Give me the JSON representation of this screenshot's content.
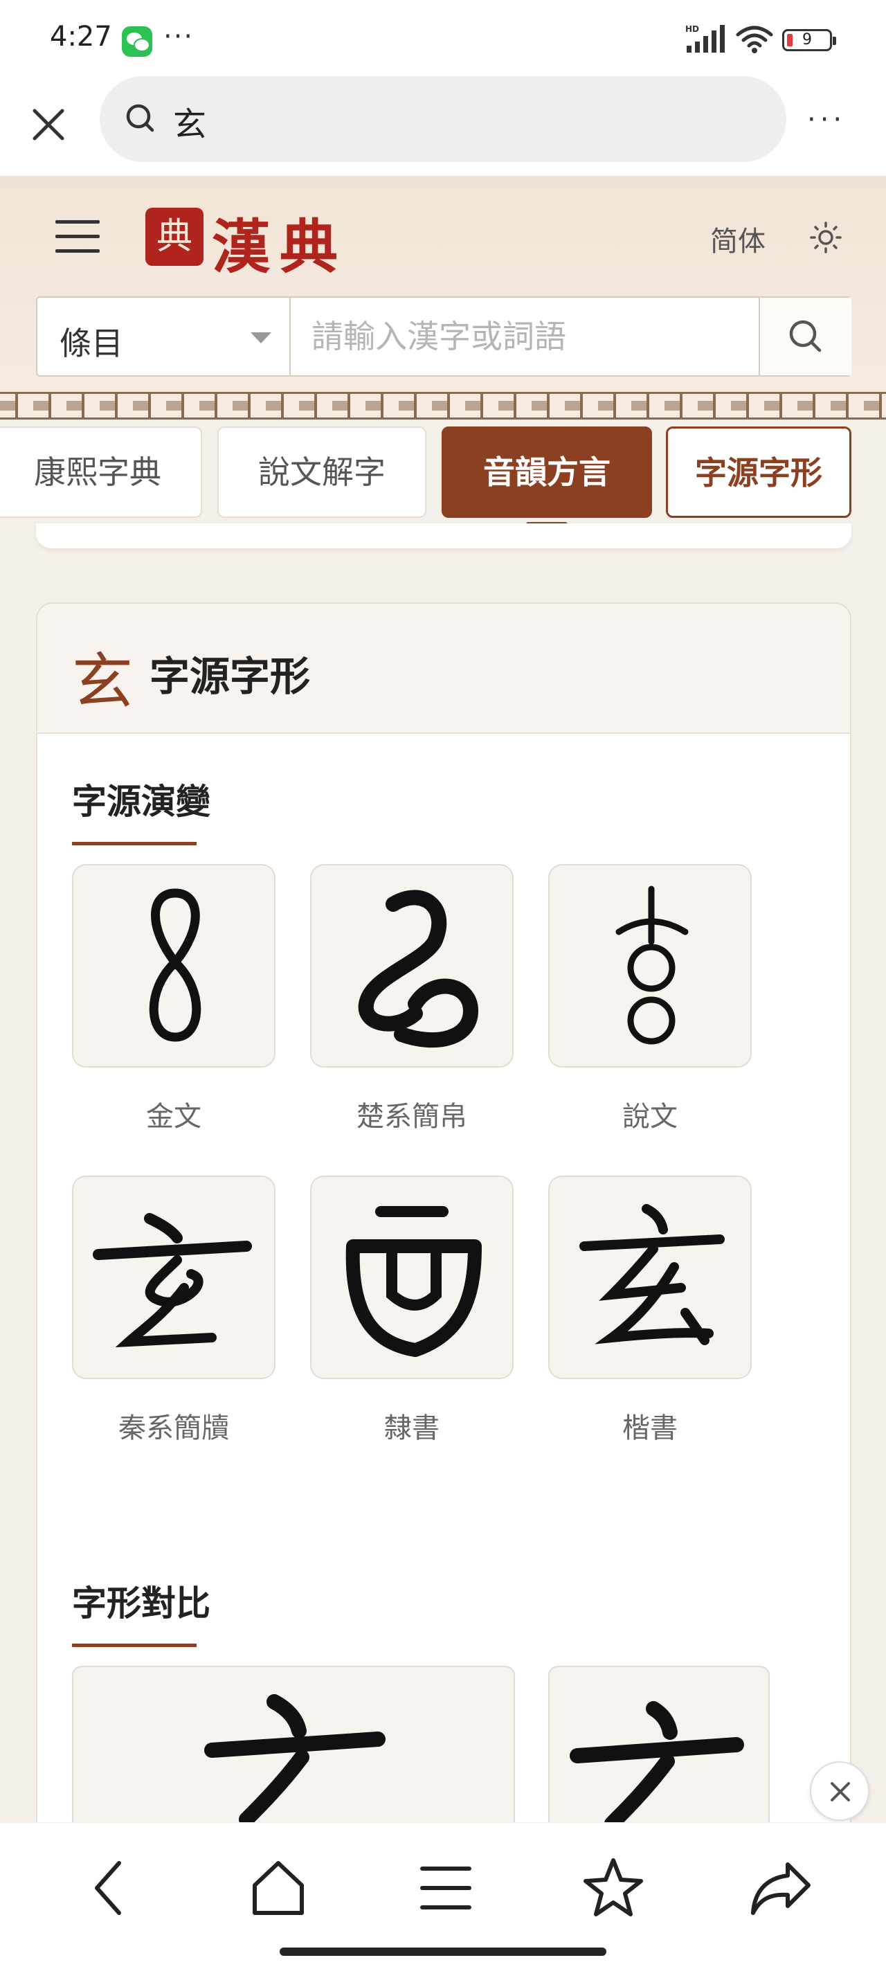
{
  "status_bar": {
    "time": "4:27",
    "more_dots": "···",
    "battery_level": "9"
  },
  "browser": {
    "query": "玄",
    "more": "···"
  },
  "site": {
    "seal_text": "典",
    "brand": "漢典",
    "simplified_label": "简体",
    "search": {
      "category": "條目",
      "placeholder": "請輸入漢字或詞語"
    }
  },
  "tabs": [
    "康熙字典",
    "說文解字",
    "音韻方言",
    "字源字形"
  ],
  "active_tab": "音韻方言",
  "card": {
    "char": "玄",
    "title": "字源字形",
    "evolution_title": "字源演變",
    "glyph_labels": [
      "金文",
      "楚系簡帛",
      "說文",
      "秦系簡牘",
      "隸書",
      "楷書"
    ],
    "comparison_title": "字形對比",
    "comparison_chars": [
      "玄",
      "玄"
    ]
  },
  "accent_color": "#8b4121",
  "brand_color": "#b0241e"
}
